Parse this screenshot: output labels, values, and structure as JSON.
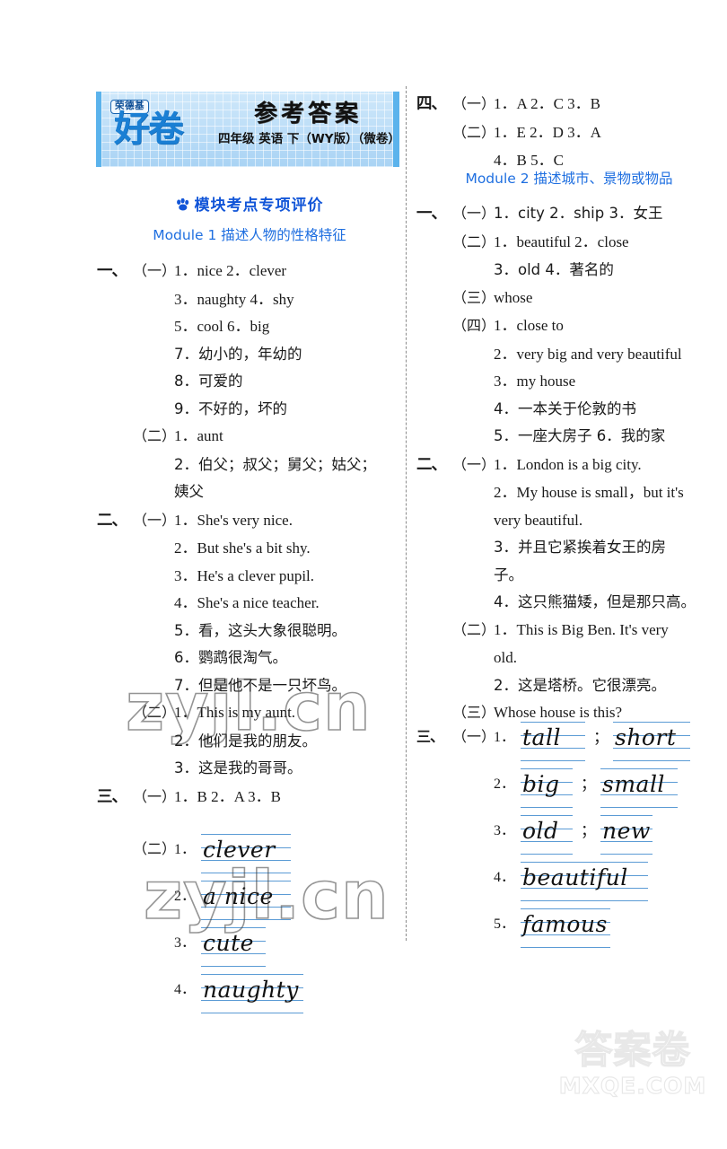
{
  "header": {
    "brand_box": "荣德基",
    "brand_script": "好卷",
    "title": "参考答案",
    "subtitle": "四年级 英语 下（WY版）（微卷）"
  },
  "left_column": {
    "section_heading": "模块考点专项评价",
    "module_heading": "Module 1 描述人物的性格特征",
    "blocks": [
      {
        "big": "一、",
        "groups": [
          {
            "paren": "（一）",
            "lines": [
              "1．nice   2．clever",
              "3．naughty   4．shy",
              "5．cool   6．big",
              "7．幼小的，年幼的",
              "8．可爱的",
              "9．不好的，坏的"
            ]
          },
          {
            "paren": "（二）",
            "lines": [
              "1．aunt",
              "2．伯父；叔父；舅父；姑父；",
              "姨父"
            ]
          }
        ]
      },
      {
        "big": "二、",
        "groups": [
          {
            "paren": "（一）",
            "lines": [
              "1．She's very nice.",
              "2．But she's a bit shy.",
              "3．He's a clever pupil.",
              "4．She's a nice teacher.",
              "5．看，这头大象很聪明。",
              "6．鹦鹉很淘气。",
              "7．但是他不是一只坏鸟。"
            ]
          },
          {
            "paren": "（二）",
            "lines": [
              "1．This is my aunt.",
              "2．他们是我的朋友。",
              "3．这是我的哥哥。"
            ]
          }
        ]
      },
      {
        "big": "三、",
        "groups": [
          {
            "paren": "（一）",
            "lines": [
              "1．B   2．A   3．B"
            ]
          }
        ]
      }
    ],
    "handwriting": {
      "paren": "（二）",
      "items": [
        {
          "num": "1．",
          "words": [
            "clever"
          ]
        },
        {
          "num": "2．",
          "words": [
            "a nice"
          ]
        },
        {
          "num": "3．",
          "words": [
            "cute"
          ]
        },
        {
          "num": "4．",
          "words": [
            "naughty"
          ]
        }
      ]
    }
  },
  "right_column": {
    "module_heading": "Module 2 描述城市、景物或物品",
    "blocks": [
      {
        "big": "四、",
        "groups": [
          {
            "paren": "（一）",
            "lines": [
              "1．A   2．C   3．B"
            ]
          },
          {
            "paren": "（二）",
            "lines": [
              "1．E   2．D   3．A",
              "4．B   5．C"
            ]
          }
        ]
      },
      {
        "big": "一、",
        "groups": [
          {
            "paren": "（一）",
            "lines": [
              "1．city   2．ship   3．女王"
            ]
          },
          {
            "paren": "（二）",
            "lines": [
              "1．beautiful   2．close",
              "3．old   4．著名的"
            ]
          },
          {
            "paren": "（三）",
            "lines": [
              "whose"
            ]
          },
          {
            "paren": "（四）",
            "lines": [
              "1．close to",
              "2．very big and very beautiful",
              "3．my house",
              "4．一本关于伦敦的书",
              "5．一座大房子   6．我的家"
            ]
          }
        ]
      },
      {
        "big": "二、",
        "groups": [
          {
            "paren": "（一）",
            "lines": [
              "1．London is a big city.",
              "2．My house is small，but it's",
              "very beautiful.",
              "3．并且它紧挨着女王的房",
              "子。",
              "4．这只熊猫矮，但是那只高。"
            ]
          },
          {
            "paren": "（二）",
            "lines": [
              "1．This is Big Ben. It's very",
              "old.",
              "2．这是塔桥。它很漂亮。"
            ]
          },
          {
            "paren": "（三）",
            "lines": [
              "Whose house is this?"
            ]
          }
        ]
      }
    ],
    "handwriting": {
      "big": "三、",
      "paren": "（一）",
      "items": [
        {
          "num": "1．",
          "words": [
            "tall",
            "short"
          ],
          "sep": "；"
        },
        {
          "num": "2．",
          "words": [
            "big",
            "small"
          ],
          "sep": "；"
        },
        {
          "num": "3．",
          "words": [
            "old",
            "new"
          ],
          "sep": "；"
        },
        {
          "num": "4．",
          "words": [
            "beautiful"
          ]
        },
        {
          "num": "5．",
          "words": [
            "famous"
          ]
        }
      ]
    }
  },
  "watermarks": {
    "overlay_text": "zyjl.cn",
    "bottom_cn": "答案卷",
    "bottom_url": "MXQE.COM"
  },
  "colors": {
    "banner_blue": "#5bb3ec",
    "heading_blue": "#1155d8",
    "module_blue": "#1f6fe0",
    "rule_blue": "#5b9bd5"
  }
}
